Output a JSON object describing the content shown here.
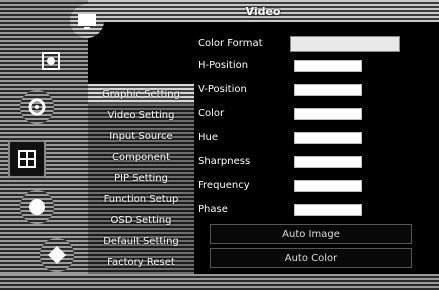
{
  "window": {
    "title": "Video"
  },
  "left_icons": [
    {
      "name": "display-icon"
    },
    {
      "name": "picture-icon"
    },
    {
      "name": "settings-icon"
    },
    {
      "name": "grid-icon"
    },
    {
      "name": "audio-icon"
    },
    {
      "name": "power-icon"
    }
  ],
  "menu": {
    "items": [
      {
        "label": "Graphic Setting",
        "active": true
      },
      {
        "label": "Video Setting",
        "active": false
      },
      {
        "label": "Input Source",
        "active": false
      },
      {
        "label": "Component",
        "active": false
      },
      {
        "label": "PIP Setting",
        "active": false
      },
      {
        "label": "Function Setup",
        "active": false
      },
      {
        "label": "OSD Setting",
        "active": false
      },
      {
        "label": "Default Setting",
        "active": false
      },
      {
        "label": "Factory Reset",
        "active": false
      }
    ]
  },
  "settings": {
    "color_format": {
      "label": "Color Format",
      "value": ""
    },
    "rows": [
      {
        "label": "H-Position",
        "level": 1.0
      },
      {
        "label": "V-Position",
        "level": 1.0
      },
      {
        "label": "Color",
        "level": 1.0
      },
      {
        "label": "Hue",
        "level": 1.0
      },
      {
        "label": "Sharpness",
        "level": 1.0
      },
      {
        "label": "Frequency",
        "level": 1.0
      },
      {
        "label": "Phase",
        "level": 1.0
      }
    ]
  },
  "actions": {
    "auto_image": "Auto Image",
    "auto_color": "Auto Color"
  },
  "colors": {
    "background": "#000000",
    "bar_fill": "#ffffff",
    "band": "#9a9a9a"
  }
}
